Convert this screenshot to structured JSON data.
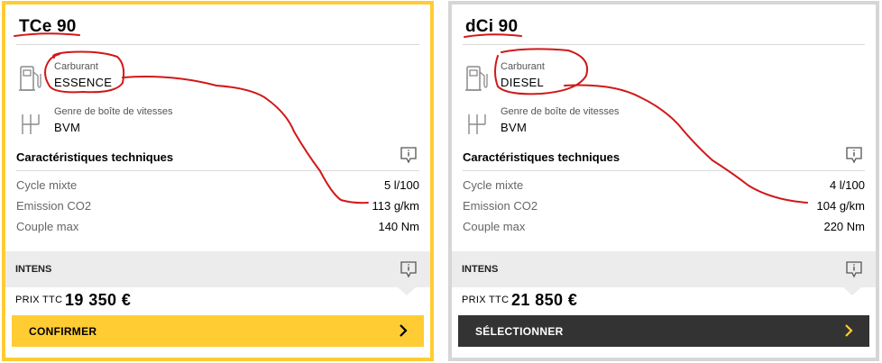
{
  "cards": [
    {
      "engine": "TCe 90",
      "fuel": {
        "label": "Carburant",
        "value": "ESSENCE",
        "icon": "fuel-pump-icon"
      },
      "gearbox": {
        "label": "Genre de boîte de vitesses",
        "value": "BVM",
        "icon": "gearbox-icon"
      },
      "tech_title": "Caractéristiques techniques",
      "specs": [
        {
          "label": "Cycle mixte",
          "value": "5 l/100"
        },
        {
          "label": "Emission CO2",
          "value": "113 g/km"
        },
        {
          "label": "Couple max",
          "value": "140 Nm"
        }
      ],
      "version": "INTENS",
      "price_label": "PRIX TTC",
      "price": "19 350 €",
      "cta": "CONFIRMER",
      "selected": true
    },
    {
      "engine": "dCi 90",
      "fuel": {
        "label": "Carburant",
        "value": "DIESEL",
        "icon": "fuel-pump-icon"
      },
      "gearbox": {
        "label": "Genre de boîte de vitesses",
        "value": "BVM",
        "icon": "gearbox-icon"
      },
      "tech_title": "Caractéristiques techniques",
      "specs": [
        {
          "label": "Cycle mixte",
          "value": "4 l/100"
        },
        {
          "label": "Emission CO2",
          "value": "104 g/km"
        },
        {
          "label": "Couple max",
          "value": "220 Nm"
        }
      ],
      "version": "INTENS",
      "price_label": "PRIX TTC",
      "price": "21 850 €",
      "cta": "SÉLECTIONNER",
      "selected": false
    }
  ],
  "colors": {
    "accent_yellow": "#ffcc33",
    "dark_button": "#333333",
    "annotation_red": "#d11818",
    "card_border_inactive": "#d6d6d6",
    "version_bar": "#ececec"
  }
}
